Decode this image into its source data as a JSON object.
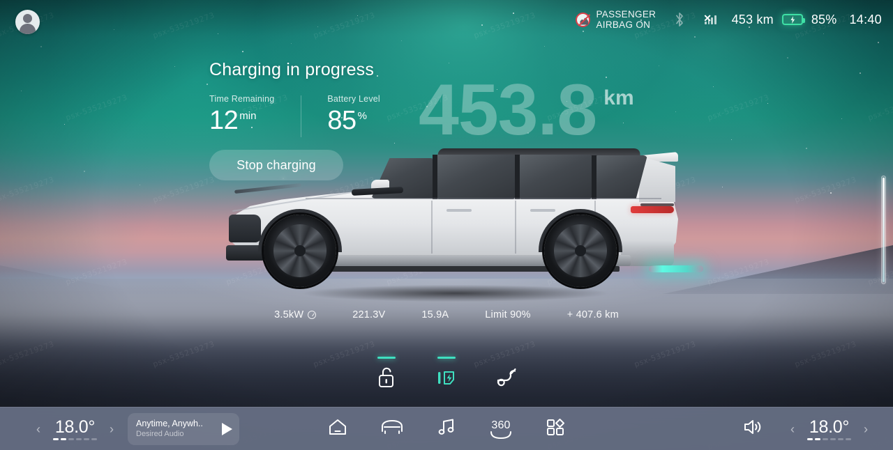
{
  "statusbar": {
    "avatar_name": "driver-avatar",
    "airbag_line1": "PASSENGER",
    "airbag_line2": "AIRBAG ON",
    "bluetooth_icon": "bluetooth-icon",
    "signal_icon": "cellular-signal-no-service-icon",
    "range": "453 km",
    "battery_icon": "battery-charging-icon",
    "battery_percent": "85%",
    "clock": "14:40",
    "battery_accent": "#3ee0a5"
  },
  "charge_panel": {
    "title": "Charging in progress",
    "time_label": "Time Remaining",
    "time_value": "12",
    "time_unit": "min",
    "battery_label": "Battery Level",
    "battery_value": "85",
    "battery_unit": "%",
    "stop_button": "Stop charging"
  },
  "big_range": {
    "value": "453.8",
    "unit": "km"
  },
  "metrics": [
    {
      "name": "charge-power",
      "text": "3.5kW",
      "has_info": true
    },
    {
      "name": "charge-voltage",
      "text": "221.3V",
      "has_info": false
    },
    {
      "name": "charge-current",
      "text": "15.9A",
      "has_info": false
    },
    {
      "name": "charge-limit",
      "text": "Limit 90%",
      "has_info": false
    },
    {
      "name": "added-range",
      "text": "+ 407.6 km",
      "has_info": false
    }
  ],
  "actions": [
    {
      "name": "charge-port-unlock-button",
      "icon": "unlock-icon",
      "active": false,
      "tick": true
    },
    {
      "name": "charging-status-button",
      "icon": "charge-port-bolt-icon",
      "active": true,
      "tick": true
    },
    {
      "name": "charge-cable-button",
      "icon": "charging-cable-icon",
      "active": false,
      "tick": false
    }
  ],
  "accent": {
    "teal": "#3fe0c0",
    "red": "#d9414a"
  },
  "taskbar": {
    "left_temp": {
      "value": "18.0",
      "degree": "°",
      "fan_on": 2,
      "fan_total": 6,
      "prev_icon": "chevron-left-icon",
      "next_icon": "chevron-right-icon"
    },
    "media": {
      "title": "Anytime, Anywh..",
      "subtitle": "Desired Audio",
      "play_icon": "play-icon"
    },
    "dock": [
      {
        "name": "dock-home-button",
        "icon": "home-icon",
        "label": ""
      },
      {
        "name": "dock-vehicle-button",
        "icon": "car-icon",
        "label": ""
      },
      {
        "name": "dock-music-button",
        "icon": "music-note-icon",
        "label": ""
      },
      {
        "name": "dock-surround-view-button",
        "icon": "360-camera-icon",
        "label": "360"
      },
      {
        "name": "dock-apps-button",
        "icon": "apps-grid-icon",
        "label": ""
      }
    ],
    "volume_icon": "speaker-volume-icon",
    "right_temp": {
      "value": "18.0",
      "degree": "°",
      "fan_on": 2,
      "fan_total": 6,
      "prev_icon": "chevron-left-icon",
      "next_icon": "chevron-right-icon"
    }
  },
  "edge_slider": {
    "name": "screen-brightness-slider"
  },
  "watermark": {
    "text": "psx-535219273"
  }
}
